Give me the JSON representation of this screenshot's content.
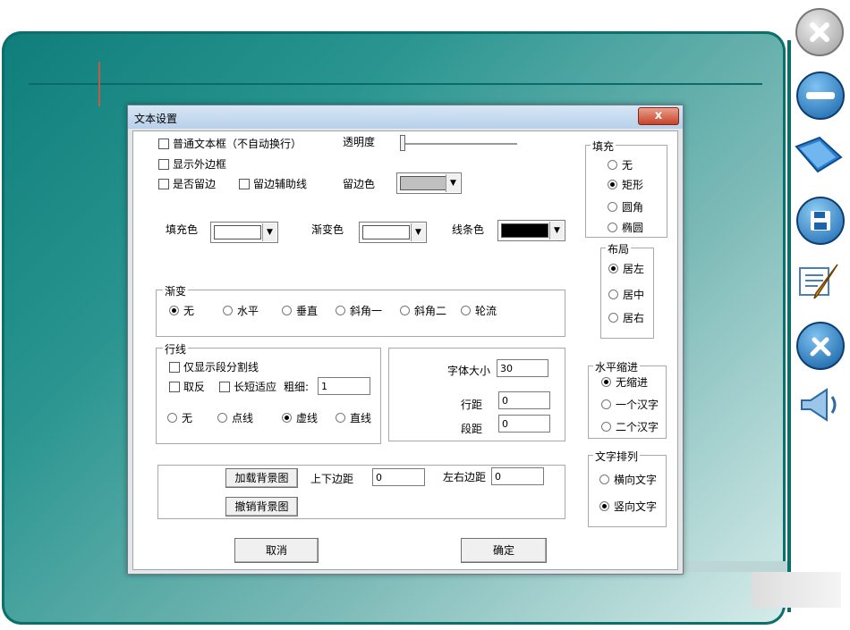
{
  "dialog": {
    "title": "文本设置",
    "close_glyph": "x"
  },
  "options": {
    "plain_textbox": "普通文本框（不自动换行）",
    "show_border": "显示外边框",
    "keep_margin": "是否留边",
    "margin_guide": "留边辅助线",
    "transparency": "透明度",
    "margin_color": "留边色",
    "fill_color": "填充色",
    "gradient_color": "渐变色",
    "line_color": "线条色"
  },
  "colors": {
    "margin_color": "#c0c0c0",
    "fill_color": "#ffffff",
    "gradient_color": "#ffffff",
    "line_color": "#000000"
  },
  "gradient": {
    "label": "渐变",
    "options": [
      "无",
      "水平",
      "垂直",
      "斜角一",
      "斜角二",
      "轮流"
    ],
    "selected": 0
  },
  "row_lines": {
    "label": "行线",
    "only_para": "仅显示段分割线",
    "invert": "取反",
    "adapt_length": "长短适应",
    "thickness_label": "粗细:",
    "thickness_value": "1",
    "styles": [
      "无",
      "点线",
      "虚线",
      "直线"
    ],
    "selected": 2
  },
  "font": {
    "size_label": "字体大小",
    "size_value": "30",
    "line_spacing_label": "行距",
    "line_spacing_value": "0",
    "para_spacing_label": "段距",
    "para_spacing_value": "0"
  },
  "background": {
    "load_button": "加载背景图",
    "cancel_button": "撤销背景图",
    "vmargin_label": "上下边距",
    "vmargin_value": "0",
    "hmargin_label": "左右边距",
    "hmargin_value": "0"
  },
  "fill": {
    "label": "填充",
    "options": [
      "无",
      "矩形",
      "圆角",
      "椭圆"
    ],
    "selected": 1
  },
  "layout": {
    "label": "布局",
    "options": [
      "居左",
      "居中",
      "居右"
    ],
    "selected": 0
  },
  "indent": {
    "label": "水平缩进",
    "options": [
      "无缩进",
      "一个汉字",
      "二个汉字"
    ],
    "selected": 0
  },
  "text_direction": {
    "label": "文字排列",
    "options": [
      "横向文字",
      "竖向文字"
    ],
    "selected": 1
  },
  "footer": {
    "cancel": "取消",
    "ok": "确定"
  },
  "side_icons": [
    "close-icon",
    "minimize-icon",
    "folder-icon",
    "save-icon",
    "edit-icon",
    "tools-icon",
    "speaker-icon"
  ]
}
